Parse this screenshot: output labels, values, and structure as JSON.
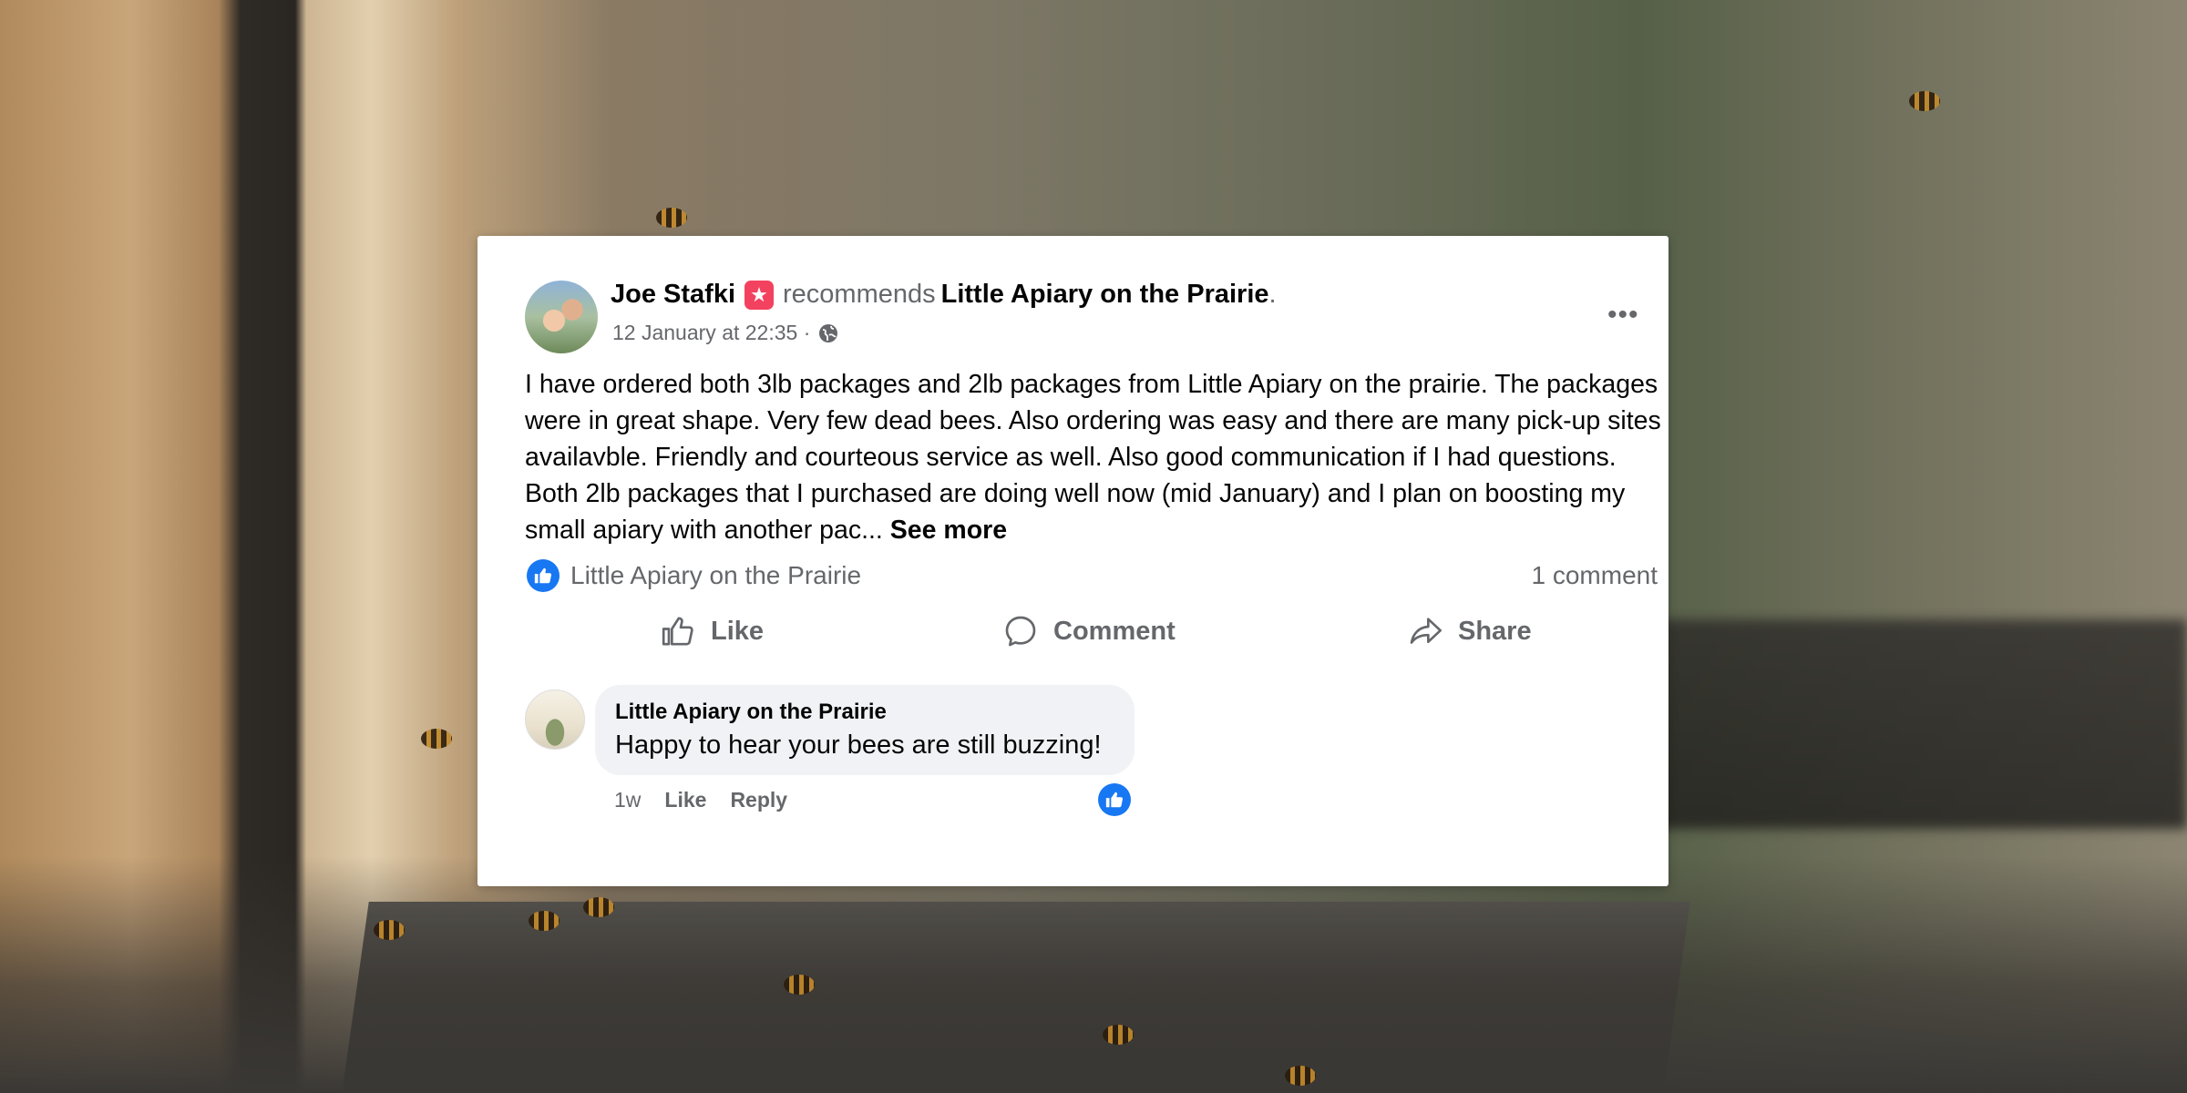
{
  "post": {
    "author": "Joe Stafki",
    "action_text": "recommends",
    "page_name": "Little Apiary on the Prairie",
    "period": ".",
    "timestamp": "12 January at 22:35 ·",
    "audience_icon": "globe-icon",
    "more_icon": "•••",
    "body": "I have ordered both 3lb packages and 2lb packages from Little Apiary on the prairie. The packages were in great shape. Very few dead bees. Also ordering was easy and there are many pick-up sites availavble. Friendly and courteous service as well. Also good communication if I had questions. Both 2lb packages that I purchased are doing well now (mid January) and I plan on boosting my small apiary with another pac...",
    "see_more": "See more"
  },
  "reactions": {
    "liked_by": "Little Apiary on the Prairie",
    "comment_count": "1 comment"
  },
  "actions": {
    "like": "Like",
    "comment": "Comment",
    "share": "Share"
  },
  "comment": {
    "author": "Little Apiary on the Prairie",
    "text": "Happy to hear your bees are still buzzing!",
    "age": "1w",
    "like_label": "Like",
    "reply_label": "Reply"
  },
  "colors": {
    "accent_blue": "#1877f2",
    "recommend_red": "#f3425f",
    "text_primary": "#050505",
    "text_secondary": "#65676b",
    "bubble_bg": "#f0f2f5"
  }
}
